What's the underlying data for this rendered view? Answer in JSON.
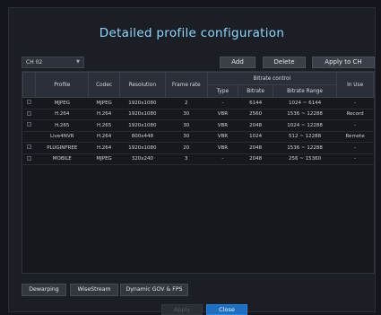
{
  "title": "Detailed profile configuration",
  "channel": {
    "selected": "CH 02"
  },
  "toolbar": {
    "add_label": "Add",
    "delete_label": "Delete",
    "apply_ch_label": "Apply to CH"
  },
  "table": {
    "headers": {
      "profile": "Profile",
      "codec": "Codec",
      "resolution": "Resolution",
      "frame_rate": "Frame rate",
      "bitrate_control": "Bitrate control",
      "type": "Type",
      "bitrate": "Bitrate",
      "bitrate_range": "Bitrate Range",
      "in_use": "In Use"
    },
    "rows": [
      {
        "profile": "MJPEG",
        "codec": "MJPEG",
        "resolution": "1920x1080",
        "frame_rate": "2",
        "type": "-",
        "bitrate": "6144",
        "bitrate_range": "1024 ~ 6144",
        "in_use": "-"
      },
      {
        "profile": "H.264",
        "codec": "H.264",
        "resolution": "1920x1080",
        "frame_rate": "30",
        "type": "VBR",
        "bitrate": "2560",
        "bitrate_range": "1536 ~ 12288",
        "in_use": "Record"
      },
      {
        "profile": "H.265",
        "codec": "H.265",
        "resolution": "1920x1080",
        "frame_rate": "30",
        "type": "VBR",
        "bitrate": "2048",
        "bitrate_range": "1024 ~ 12288",
        "in_use": "-"
      },
      {
        "profile": "Live4NVR",
        "codec": "H.264",
        "resolution": "800x448",
        "frame_rate": "30",
        "type": "VBR",
        "bitrate": "1024",
        "bitrate_range": "512 ~ 12288",
        "in_use": "Remote"
      },
      {
        "profile": "PLUGINFREE",
        "codec": "H.264",
        "resolution": "1920x1080",
        "frame_rate": "20",
        "type": "VBR",
        "bitrate": "2048",
        "bitrate_range": "1536 ~ 12288",
        "in_use": "-"
      },
      {
        "profile": "MOBILE",
        "codec": "MJPEG",
        "resolution": "320x240",
        "frame_rate": "3",
        "type": "-",
        "bitrate": "2048",
        "bitrate_range": "256 ~ 15360",
        "in_use": "-"
      }
    ]
  },
  "features": {
    "dewarping": "Dewarping",
    "wisestream": "WiseStream",
    "dynamic_gov": "Dynamic GOV & FPS"
  },
  "footer": {
    "apply_label": "Apply",
    "close_label": "Close"
  }
}
